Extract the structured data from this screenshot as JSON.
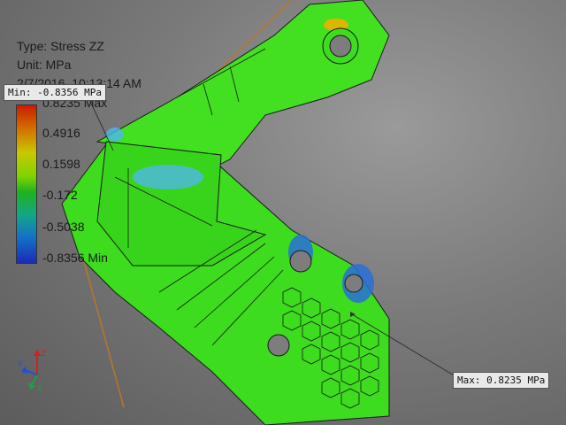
{
  "result": {
    "type_line": "Type: Stress ZZ",
    "unit_line": "Unit: MPa",
    "date_line": "2/7/2016, 10:13:14 AM"
  },
  "legend": {
    "labels": [
      "0.8235 Max",
      "0.4916",
      "0.1598",
      "-0.172",
      "-0.5038",
      "-0.8356 Min"
    ]
  },
  "callouts": {
    "min": "Min: -0.8356 MPa",
    "max": "Max: 0.8235 MPa"
  },
  "triad": {
    "x": "X",
    "y": "Y",
    "z": "Z"
  },
  "colors": {
    "background": "#7a7a7a",
    "model_green": "#3ddc1e",
    "high_stress": "#c81e00",
    "low_stress": "#1c2ab4"
  }
}
